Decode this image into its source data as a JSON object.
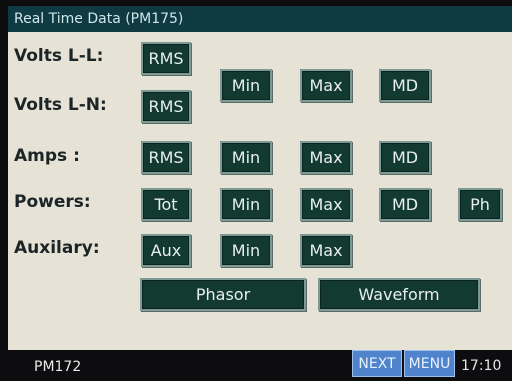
{
  "title": "Real Time Data (PM175)",
  "rows": {
    "volts_ll": {
      "label": "Volts L-L:",
      "rms": "RMS"
    },
    "volts_ln": {
      "label": "Volts L-N:",
      "rms": "RMS"
    },
    "volts_shared": {
      "min": "Min",
      "max": "Max",
      "md": "MD"
    },
    "amps": {
      "label": "Amps :",
      "rms": "RMS",
      "min": "Min",
      "max": "Max",
      "md": "MD"
    },
    "powers": {
      "label": "Powers:",
      "tot": "Tot",
      "min": "Min",
      "max": "Max",
      "md": "MD",
      "ph": "Ph"
    },
    "auxilary": {
      "label": "Auxilary:",
      "aux": "Aux",
      "min": "Min",
      "max": "Max"
    }
  },
  "bottom_buttons": {
    "phasor": "Phasor",
    "waveform": "Waveform"
  },
  "status": {
    "device": "PM172",
    "next": "NEXT",
    "menu": "MENU",
    "time": "17:10"
  },
  "colors": {
    "title_bg": "#0f3a44",
    "button_bg": "#123a30",
    "screen_bg": "#e6e3d6",
    "status_button_bg": "#4f83cc"
  }
}
